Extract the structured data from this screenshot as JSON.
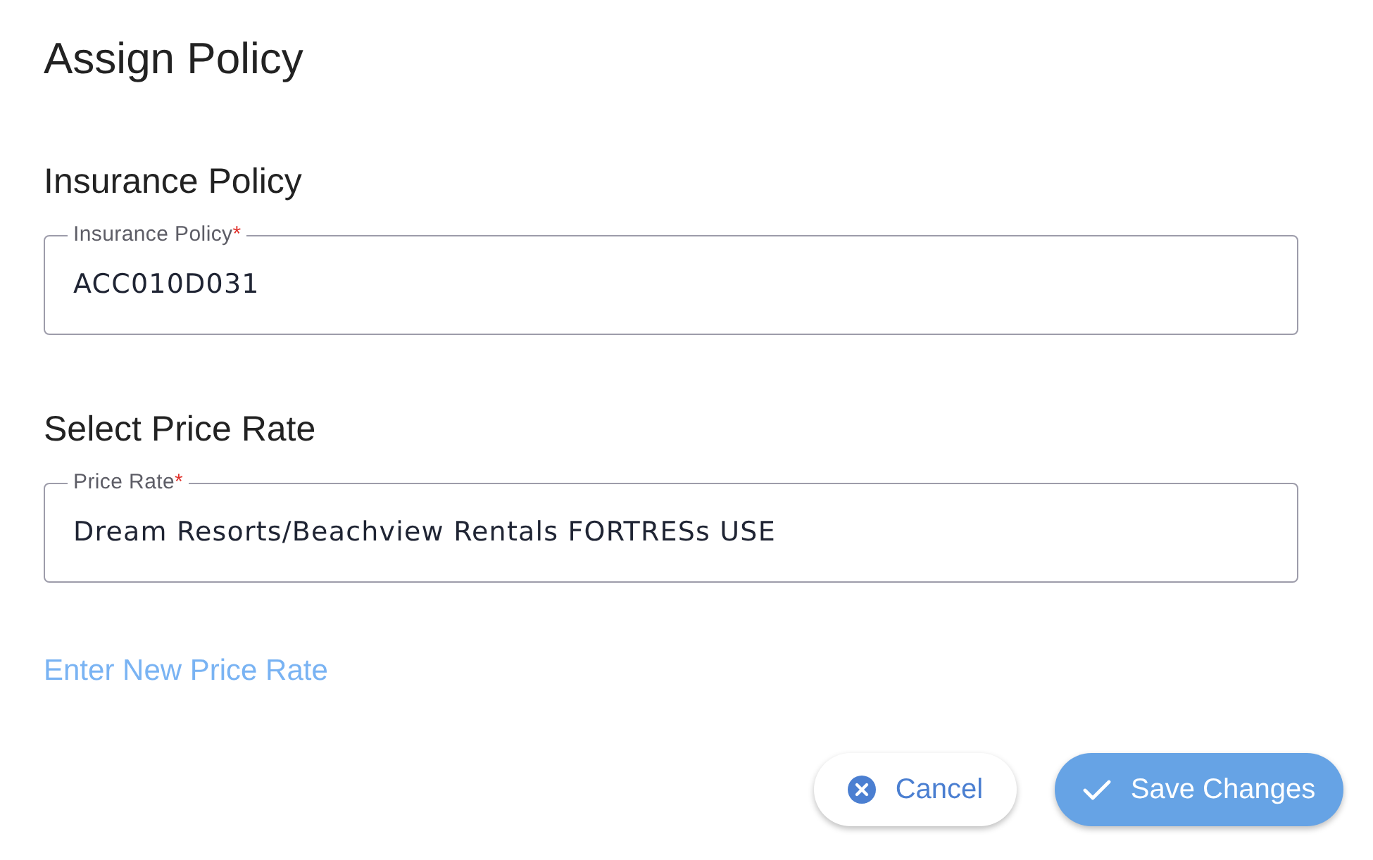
{
  "title": "Assign Policy",
  "sections": [
    {
      "heading": "Insurance Policy",
      "field": {
        "label": "Insurance Policy",
        "required_mark": "*",
        "value": "ACC010D031"
      }
    },
    {
      "heading": "Select Price Rate",
      "field": {
        "label": "Price Rate",
        "required_mark": "*",
        "value": "Dream Resorts/Beachview Rentals FORTRESs USE"
      }
    }
  ],
  "link": "Enter New Price Rate",
  "buttons": [
    {
      "label": "Cancel",
      "kind": "secondary"
    },
    {
      "label": "Save Changes",
      "kind": "primary"
    }
  ]
}
